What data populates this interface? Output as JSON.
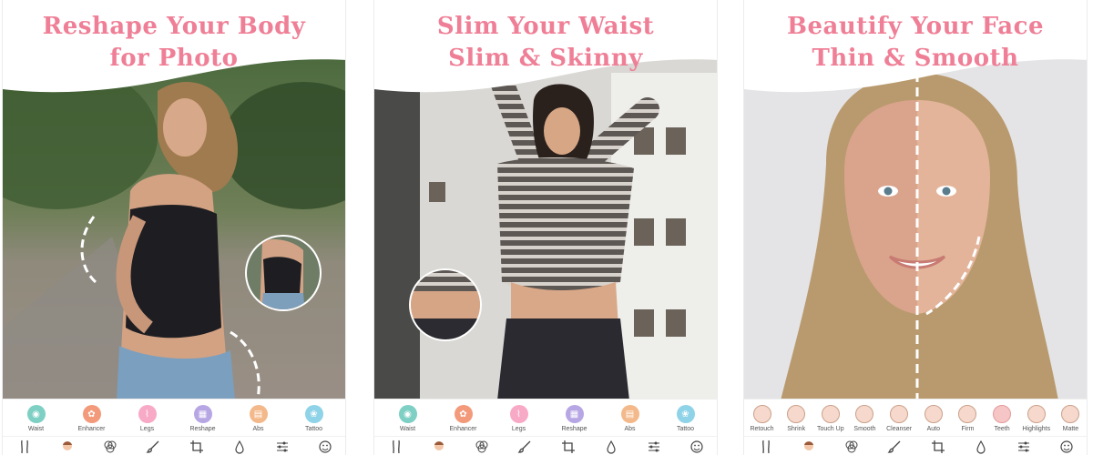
{
  "panels": [
    {
      "headline_line1": "Reshape Your Body",
      "headline_line2": "for Photo",
      "tools": [
        "Waist",
        "Enhancer",
        "Legs",
        "Reshape",
        "Abs",
        "Tattoo"
      ]
    },
    {
      "headline_line1": "Slim Your Waist",
      "headline_line2": "Slim & Skinny",
      "tools": [
        "Waist",
        "Enhancer",
        "Legs",
        "Reshape",
        "Abs",
        "Tattoo"
      ]
    },
    {
      "headline_line1": "Beautify Your Face",
      "headline_line2": "Thin & Smooth",
      "tools": [
        "Retouch",
        "Shrink",
        "Touch Up",
        "Smooth",
        "Cleanser",
        "Auto",
        "Firm",
        "Teeth",
        "Highlights",
        "Matte"
      ]
    }
  ],
  "bottom_icons": [
    "body-icon",
    "face-icon",
    "filter-icon",
    "brush-icon",
    "crop-icon",
    "drop-icon",
    "adjust-icon",
    "sticker-icon"
  ],
  "colors": {
    "accent_pink": "#ef7f96",
    "waist": "#7ecfc4",
    "enhancer": "#f39a7b",
    "legs": "#f7a9c6",
    "reshape": "#b7a6e4",
    "abs": "#f3b98b",
    "tattoo": "#8fd3e8"
  }
}
